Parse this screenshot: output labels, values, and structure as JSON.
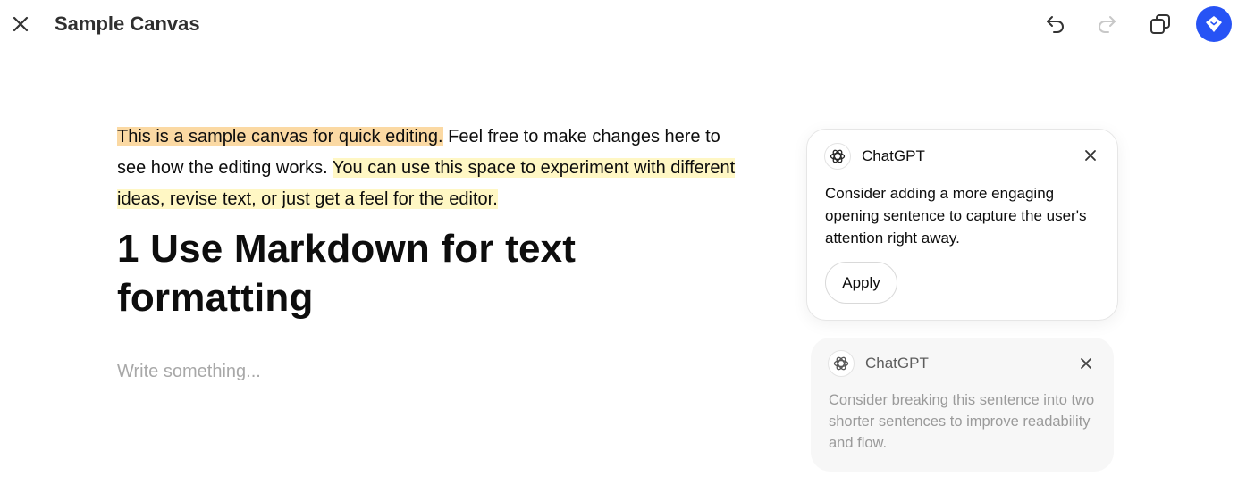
{
  "header": {
    "title": "Sample Canvas",
    "close_icon": "close-icon",
    "undo_icon": "undo-icon",
    "redo_icon": "redo-icon",
    "copy_icon": "copy-icon",
    "suggest_icon": "suggest-edits-icon",
    "accent_color": "#2753f5"
  },
  "editor": {
    "paragraph": {
      "highlight_1": "This is a sample canvas for quick editing.",
      "plain": " Feel free to make changes here to see how the editing works. ",
      "highlight_2": "You can use this space to experiment with different ideas, revise text, or just get a feel for the editor."
    },
    "heading": "1 Use Markdown for text formatting",
    "placeholder": "Write something..."
  },
  "comments": [
    {
      "author": "ChatGPT",
      "text": "Consider adding a more engaging opening sentence to capture the user's attention right away.",
      "action_label": "Apply",
      "state": "active"
    },
    {
      "author": "ChatGPT",
      "text": "Consider breaking this sentence into two shorter sentences to improve readability and flow.",
      "state": "inactive"
    }
  ],
  "colors": {
    "highlight_strong": "#fbd9a3",
    "highlight_soft": "#fff7c4"
  }
}
